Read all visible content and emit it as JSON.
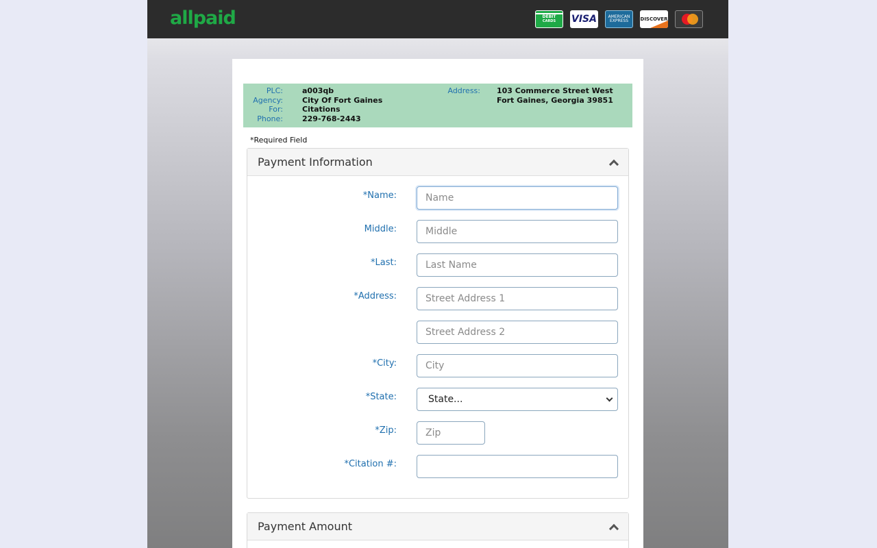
{
  "header": {
    "logo": "allpaid",
    "cards": [
      {
        "name": "debit-card-icon",
        "line1": "DEBIT",
        "line2": "CARDS"
      },
      {
        "name": "visa-icon",
        "text": "VISA"
      },
      {
        "name": "amex-icon",
        "line1": "AMERICAN",
        "line2": "EXPRESS"
      },
      {
        "name": "discover-icon",
        "text": "DISCOVER"
      },
      {
        "name": "mastercard-icon"
      }
    ]
  },
  "agency": {
    "plc_label": "PLC:",
    "plc": "a003qb",
    "agency_label": "Agency:",
    "agency": "City Of Fort Gaines",
    "for_label": "For:",
    "for": "Citations",
    "phone_label": "Phone:",
    "phone": "229-768-2443",
    "address_label": "Address:",
    "address_line1": "103 Commerce Street West",
    "address_line2": "Fort Gaines, Georgia 39851"
  },
  "required_note": "*Required Field",
  "payment_info": {
    "title": "Payment Information",
    "name_label": "*Name:",
    "name_placeholder": "Name",
    "middle_label": "Middle:",
    "middle_placeholder": "Middle",
    "last_label": "*Last:",
    "last_placeholder": "Last Name",
    "address_label": "*Address:",
    "address1_placeholder": "Street Address 1",
    "address2_placeholder": "Street Address 2",
    "city_label": "*City:",
    "city_placeholder": "City",
    "state_label": "*State:",
    "state_value": "State...",
    "zip_label": "*Zip:",
    "zip_placeholder": "Zip",
    "citation_label": "*Citation #:",
    "citation_value": ""
  },
  "payment_amount": {
    "title": "Payment Amount"
  },
  "colors": {
    "brand_green": "#1fa946",
    "label_blue": "#1f6fae",
    "agency_bg": "#aad9bc",
    "topbar": "#2c2c2c"
  }
}
